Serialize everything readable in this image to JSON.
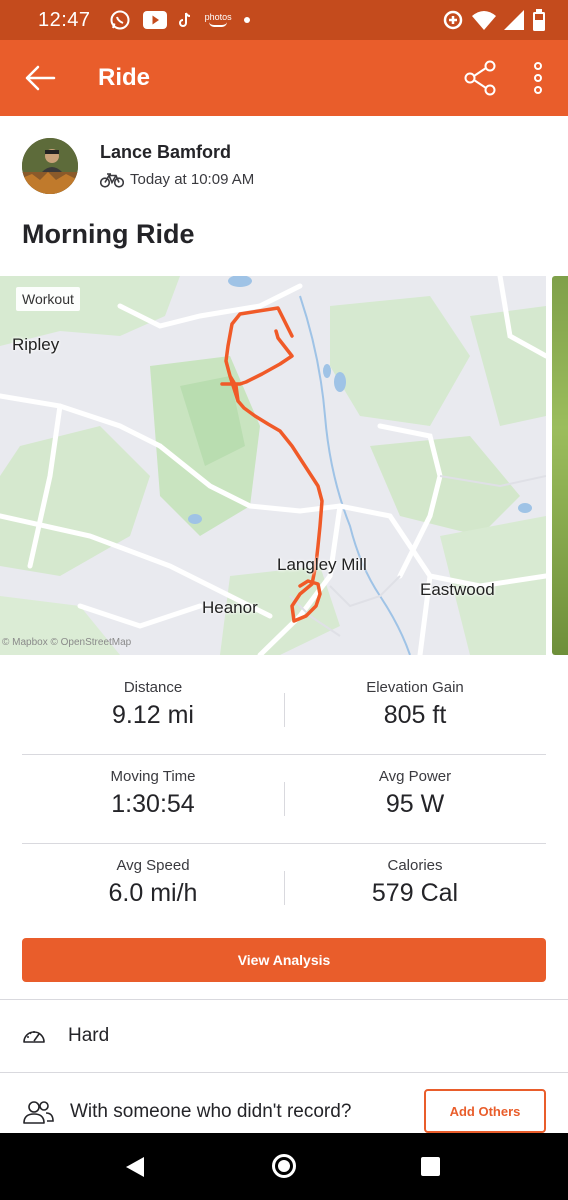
{
  "status_bar": {
    "time": "12:47",
    "left_icons": [
      "whatsapp-icon",
      "youtube-icon",
      "tiktok-icon",
      "amazon-photos-icon",
      "notification-dot-icon"
    ],
    "photos_label": "photos",
    "right_icons": [
      "data-saver-icon",
      "wifi-icon",
      "signal-icon",
      "battery-icon"
    ]
  },
  "app_bar": {
    "title": "Ride",
    "back_icon": "arrow-left-icon",
    "share_icon": "share-icon",
    "more_icon": "more-vertical-icon"
  },
  "colors": {
    "brand": "#e95d2b",
    "status_bar": "#c44b1d",
    "route": "#f05a28"
  },
  "athlete": {
    "name": "Lance Bamford",
    "activity_icon": "bike-icon",
    "time": "Today at 10:09 AM"
  },
  "activity": {
    "title": "Morning Ride"
  },
  "map": {
    "tag": "Workout",
    "places": {
      "ripley": "Ripley",
      "langley_mill": "Langley Mill",
      "heanor": "Heanor",
      "eastwood": "Eastwood"
    },
    "attribution": "© Mapbox © OpenStreetMap"
  },
  "stats": [
    {
      "left": {
        "label": "Distance",
        "value": "9.12 mi"
      },
      "right": {
        "label": "Elevation Gain",
        "value": "805 ft"
      }
    },
    {
      "left": {
        "label": "Moving Time",
        "value": "1:30:54"
      },
      "right": {
        "label": "Avg Power",
        "value": "95 W"
      }
    },
    {
      "left": {
        "label": "Avg Speed",
        "value": "6.0 mi/h"
      },
      "right": {
        "label": "Calories",
        "value": "579 Cal"
      }
    }
  ],
  "actions": {
    "view_analysis": "View Analysis",
    "perceived_exertion": "Hard",
    "perceived_icon": "gauge-icon",
    "with_others": "With someone who didn't record?",
    "with_others_icon": "people-icon",
    "add_others": "Add Others"
  },
  "nav_bar": {
    "icons": [
      "back-triangle-icon",
      "home-circle-icon",
      "recents-square-icon"
    ]
  }
}
